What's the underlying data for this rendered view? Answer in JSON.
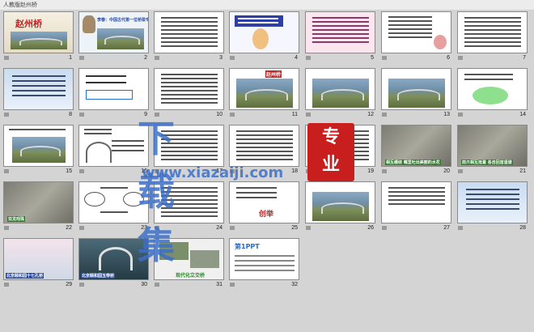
{
  "app": {
    "title": "人教版赵州桥"
  },
  "colors": {
    "sorter_bg": "#d4d4d4",
    "accent_red": "#c81e1e",
    "watermark_blue": "#3c6ec8"
  },
  "slides": [
    {
      "num": "1",
      "title": "赵州桥",
      "style": "title"
    },
    {
      "num": "2",
      "caption": "李春：中国古代第一位桥梁专家",
      "style": "portrait"
    },
    {
      "num": "3",
      "style": "text"
    },
    {
      "num": "4",
      "style": "cartoon"
    },
    {
      "num": "5",
      "style": "text-pink"
    },
    {
      "num": "6",
      "style": "text-cartoon"
    },
    {
      "num": "7",
      "style": "text"
    },
    {
      "num": "8",
      "style": "sky"
    },
    {
      "num": "9",
      "style": "question"
    },
    {
      "num": "10",
      "style": "text"
    },
    {
      "num": "11",
      "caption": "赵州桥",
      "style": "bridge"
    },
    {
      "num": "12",
      "style": "bridge"
    },
    {
      "num": "13",
      "style": "bridge"
    },
    {
      "num": "14",
      "style": "bubble"
    },
    {
      "num": "15",
      "style": "text-bridge"
    },
    {
      "num": "16",
      "style": "arch-diagram"
    },
    {
      "num": "17",
      "style": "text"
    },
    {
      "num": "18",
      "style": "text"
    },
    {
      "num": "19",
      "style": "text"
    },
    {
      "num": "20",
      "caption": "相互缠绕 嘴里吐出美丽的水花",
      "style": "carving"
    },
    {
      "num": "21",
      "caption": "前爪相互抵着 各自回首遥望",
      "style": "carving"
    },
    {
      "num": "22",
      "caption": "双龙戏珠",
      "style": "carving-green"
    },
    {
      "num": "23",
      "style": "diagram"
    },
    {
      "num": "24",
      "style": "text"
    },
    {
      "num": "25",
      "caption": "创举",
      "style": "text-red"
    },
    {
      "num": "26",
      "style": "bridge"
    },
    {
      "num": "27",
      "style": "text-small"
    },
    {
      "num": "28",
      "style": "sky"
    },
    {
      "num": "29",
      "caption": "北京颐和园十七孔桥",
      "style": "bridge-tree"
    },
    {
      "num": "30",
      "caption": "北京颐和园玉带桥",
      "style": "arch-photo"
    },
    {
      "num": "31",
      "caption": "现代化立交桥",
      "style": "interchange"
    },
    {
      "num": "32",
      "caption": "第1PPT",
      "style": "ad"
    }
  ],
  "watermark": {
    "title": "下载集",
    "url": "www.xiazaiji.com",
    "seal_line1": "专",
    "seal_line2": "业"
  }
}
